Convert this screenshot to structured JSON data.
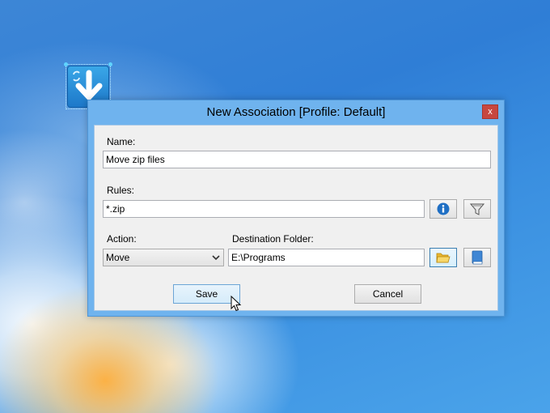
{
  "dialog": {
    "title": "New Association [Profile: Default]",
    "close_glyph": "x"
  },
  "form": {
    "name_label": "Name:",
    "name_value": "Move zip files",
    "rules_label": "Rules:",
    "rules_value": "*.zip",
    "action_label": "Action:",
    "action_value": "Move",
    "destination_label": "Destination Folder:",
    "destination_value": "E:\\Programs"
  },
  "buttons": {
    "save_label": "Save",
    "cancel_label": "Cancel"
  },
  "icons": {
    "desktop_app": "download-arrow-icon",
    "info": "info-icon",
    "filter": "filter-icon",
    "folder": "folder-icon",
    "book": "book-icon",
    "dropdown": "chevron-down-icon",
    "cursor": "mouse-pointer-icon"
  },
  "colors": {
    "close_button": "#c7473f",
    "title_bar": "#6fb3ee",
    "info_icon": "#1f6fc4",
    "folder_icon": "#f2c94c",
    "book_icon": "#3f86d4"
  }
}
